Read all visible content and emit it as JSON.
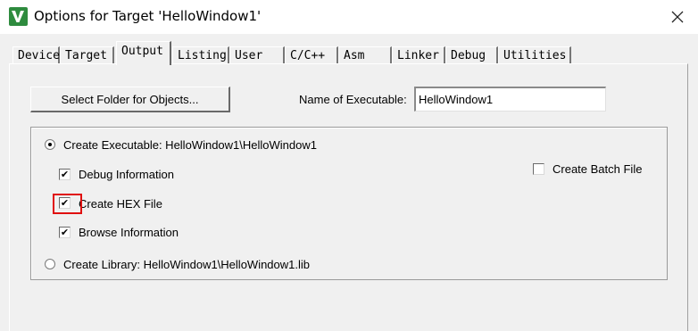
{
  "window": {
    "title": "Options for Target 'HelloWindow1'"
  },
  "tabs": [
    {
      "label": "Device"
    },
    {
      "label": "Target"
    },
    {
      "label": "Output"
    },
    {
      "label": "Listing"
    },
    {
      "label": "User"
    },
    {
      "label": "C/C++"
    },
    {
      "label": "Asm"
    },
    {
      "label": "Linker"
    },
    {
      "label": "Debug"
    },
    {
      "label": "Utilities"
    }
  ],
  "active_tab": "Output",
  "output": {
    "select_folder_label": "Select Folder for Objects...",
    "name_label": "Name of Executable:",
    "name_value": "HelloWindow1",
    "create_executable_label": "Create Executable:  HelloWindow1\\HelloWindow1",
    "create_executable_selected": true,
    "debug_info_label": "Debug Information",
    "debug_info_checked": true,
    "create_hex_label": "Create HEX File",
    "create_hex_checked": true,
    "browse_info_label": "Browse Information",
    "browse_info_checked": true,
    "create_library_label": "Create Library:  HelloWindow1\\HelloWindow1.lib",
    "create_library_selected": false,
    "batch_label": "Create Batch File",
    "batch_checked": false
  },
  "colors": {
    "highlight": "#e01010",
    "icon_green": "#2e8b3e"
  },
  "icons": {
    "app": "keil-uvision-icon",
    "close": "close-icon"
  }
}
